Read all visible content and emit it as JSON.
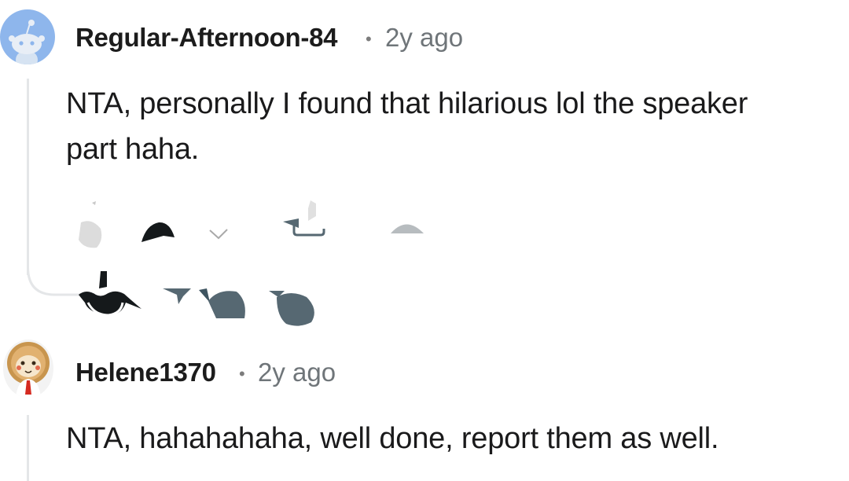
{
  "comments": [
    {
      "username": "Regular-Afternoon-84",
      "separator": "•",
      "time": "2y ago",
      "body_line1": "NTA, personally I found that hilarious lol the speaker",
      "body_line2": "part haha.",
      "avatar_icon": "snoo-avatar-icon",
      "avatar_bg": "#8eb6ec"
    },
    {
      "username": "Helene1370",
      "separator": "•",
      "time": "2y ago",
      "body_line1": "NTA, hahahahaha, well done, report them as well.",
      "avatar_icon": "custom-avatar-icon"
    }
  ],
  "actions": {
    "icons": [
      "more-icon",
      "upvote-icon",
      "downvote-icon",
      "award-icon",
      "reply-icon"
    ]
  },
  "colors": {
    "thread_line": "#e4e6e8",
    "text": "#1a1a1b",
    "meta": "#6f7579"
  }
}
